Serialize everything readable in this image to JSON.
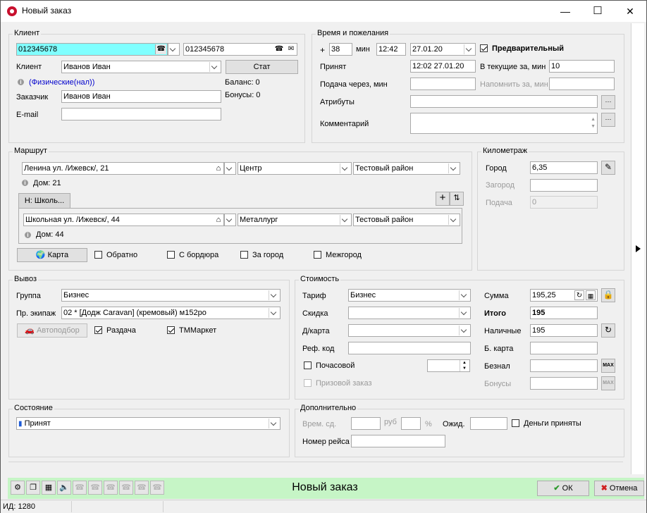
{
  "window": {
    "title": "Новый заказ",
    "minimize": "—",
    "maximize": "☐",
    "close": "✕"
  },
  "client": {
    "group_label": "Клиент",
    "phone1": "012345678",
    "phone2": "012345678",
    "client_label": "Клиент",
    "client_value": "Иванов Иван",
    "stat_button": "Стат",
    "payment_type": "(Физические(нал))",
    "balance": "Баланс: 0",
    "bonuses": "Бонусы: 0",
    "customer_label": "Заказчик",
    "customer_value": "Иванов Иван",
    "email_label": "E-mail",
    "email_value": ""
  },
  "time": {
    "group_label": "Время и пожелания",
    "plus": "+",
    "minutes_value": "38",
    "min_label": "мин",
    "time_value": "12:42",
    "date_value": "27.01.20",
    "preliminary_label": "Предварительный",
    "accepted_label": "Принят",
    "accepted_value": "12:02 27.01.20",
    "current_label": "В текущие за, мин",
    "current_value": "10",
    "supply_label": "Подача через, мин",
    "supply_value": "",
    "remind_label": "Напомнить за, мин",
    "remind_value": "",
    "attributes_label": "Атрибуты",
    "attributes_value": "",
    "comment_label": "Комментарий",
    "comment_value": "",
    "more": "···"
  },
  "route": {
    "group_label": "Маршрут",
    "from_address": "Ленина ул. /Ижевск/, 21",
    "from_district": "Центр",
    "from_area": "Тестовый район",
    "from_house": "Дом: 21",
    "tab_label": "Н: Школь...",
    "to_address": "Школьная ул. /Ижевск/, 44",
    "to_district": "Металлург",
    "to_area": "Тестовый район",
    "to_house": "Дом: 44",
    "map_button": "Карта",
    "back_label": "Обратно",
    "curb_label": "С бордюра",
    "outcity_label": "За город",
    "intercity_label": "Межгород"
  },
  "mileage": {
    "group_label": "Километраж",
    "city_label": "Город",
    "city_value": "6,35",
    "outcity_label": "Загород",
    "outcity_value": "",
    "supply_label": "Подача",
    "supply_value": "0"
  },
  "dispatch": {
    "group_label": "Вывоз",
    "group_field_label": "Группа",
    "group_value": "Бизнес",
    "crew_label": "Пр. экипаж",
    "crew_value": "02 * [Додж Caravan] (кремовый) м152ро",
    "autoselect": "Автоподбор",
    "handout_label": "Раздача",
    "tmmarket_label": "ТММаркет"
  },
  "cost": {
    "group_label": "Стоимость",
    "tariff_label": "Тариф",
    "tariff_value": "Бизнес",
    "discount_label": "Скидка",
    "discount_value": "",
    "dcard_label": "Д/карта",
    "dcard_value": "",
    "ref_label": "Реф. код",
    "ref_value": "",
    "hourly_label": "Почасовой",
    "prize_label": "Призовой заказ",
    "sum_label": "Сумма",
    "sum_value": "195,25",
    "total_label": "Итого",
    "total_value": "195",
    "cash_label": "Наличные",
    "cash_value": "195",
    "bcard_label": "Б. карта",
    "bcard_value": "",
    "noncash_label": "Безнал",
    "noncash_value": "",
    "bonus_label": "Бонусы",
    "bonus_value": "",
    "max": "MAX"
  },
  "state": {
    "group_label": "Состояние",
    "value": "Принят"
  },
  "extra": {
    "group_label": "Дополнительно",
    "time_label": "Врем. сд.",
    "rub": "руб",
    "percent": "%",
    "wait_label": "Ожид.",
    "money_received": "Деньги приняты",
    "flight_label": "Номер рейса"
  },
  "bottom": {
    "title": "Новый заказ",
    "ok": "ОК",
    "cancel": "Отмена"
  },
  "status": {
    "id": "ИД: 1280"
  },
  "colors": {
    "phone_highlight": "#80ffff",
    "bottom_bar": "#c6f5c6",
    "link": "#0000cc"
  }
}
